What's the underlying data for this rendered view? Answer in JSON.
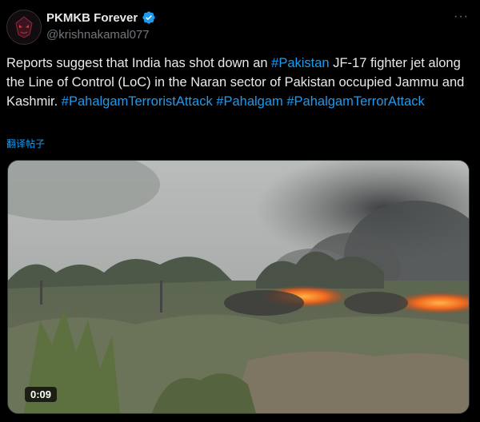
{
  "author": {
    "display_name": "PKMKB Forever",
    "handle": "@krishnakamal077",
    "avatar_icon": "avatar-logo-icon",
    "verified_icon": "verified-badge-icon"
  },
  "menu": {
    "more_label": "···"
  },
  "tweet": {
    "segments": [
      {
        "text": "Reports suggest that India has shot down an ",
        "type": "plain"
      },
      {
        "text": "#Pakistan",
        "type": "hashtag"
      },
      {
        "text": " JF-17 fighter jet along the Line of Control (LoC) in the Naran sector of Pakistan occupied Jammu and Kashmir. ",
        "type": "plain"
      },
      {
        "text": "#PahalgamTerroristAttack",
        "type": "hashtag"
      },
      {
        "text": " ",
        "type": "plain"
      },
      {
        "text": "#Pahalgam",
        "type": "hashtag"
      },
      {
        "text": " ",
        "type": "plain"
      },
      {
        "text": "#PahalgamTerrorAttack",
        "type": "hashtag"
      }
    ],
    "translate_label": "翻译帖子"
  },
  "media": {
    "duration": "0:09"
  },
  "colors": {
    "background": "#000000",
    "text": "#e7e9ea",
    "secondary": "#71767b",
    "link": "#1d9bf0"
  }
}
